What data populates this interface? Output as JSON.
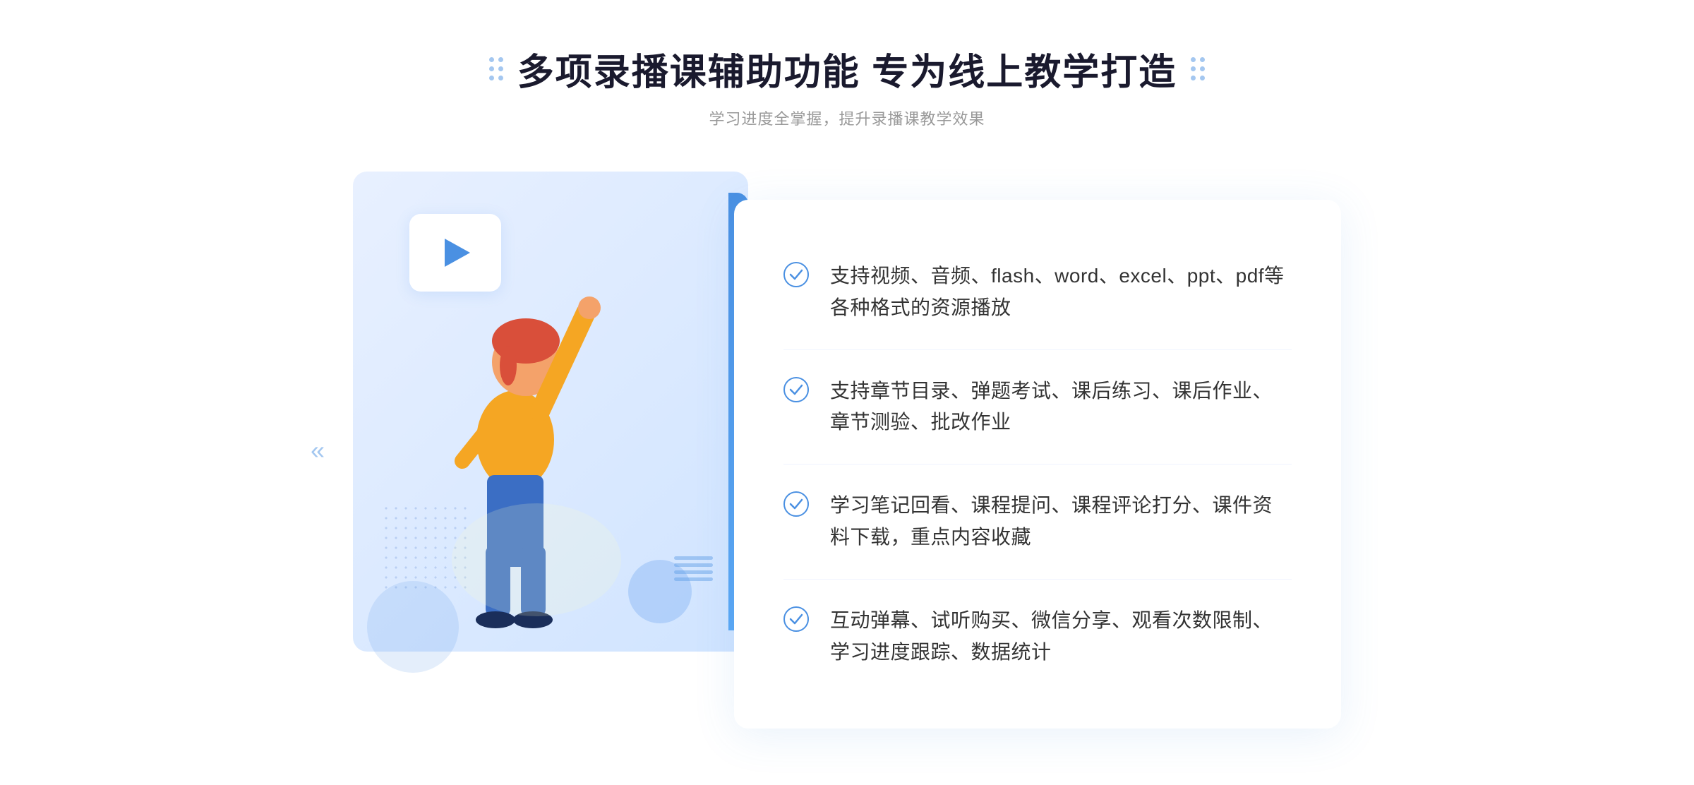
{
  "header": {
    "title": "多项录播课辅助功能 专为线上教学打造",
    "subtitle": "学习进度全掌握，提升录播课教学效果"
  },
  "features": [
    {
      "id": 1,
      "text": "支持视频、音频、flash、word、excel、ppt、pdf等各种格式的资源播放"
    },
    {
      "id": 2,
      "text": "支持章节目录、弹题考试、课后练习、课后作业、章节测验、批改作业"
    },
    {
      "id": 3,
      "text": "学习笔记回看、课程提问、课程评论打分、课件资料下载，重点内容收藏"
    },
    {
      "id": 4,
      "text": "互动弹幕、试听购买、微信分享、观看次数限制、学习进度跟踪、数据统计"
    }
  ],
  "colors": {
    "primary": "#4a90e2",
    "text_dark": "#1a1a2e",
    "text_mid": "#333",
    "text_light": "#999",
    "bg_light": "#e8f0ff"
  },
  "icons": {
    "check": "✓",
    "arrow_left": "«",
    "arrow_right": "»",
    "play": "▶"
  }
}
